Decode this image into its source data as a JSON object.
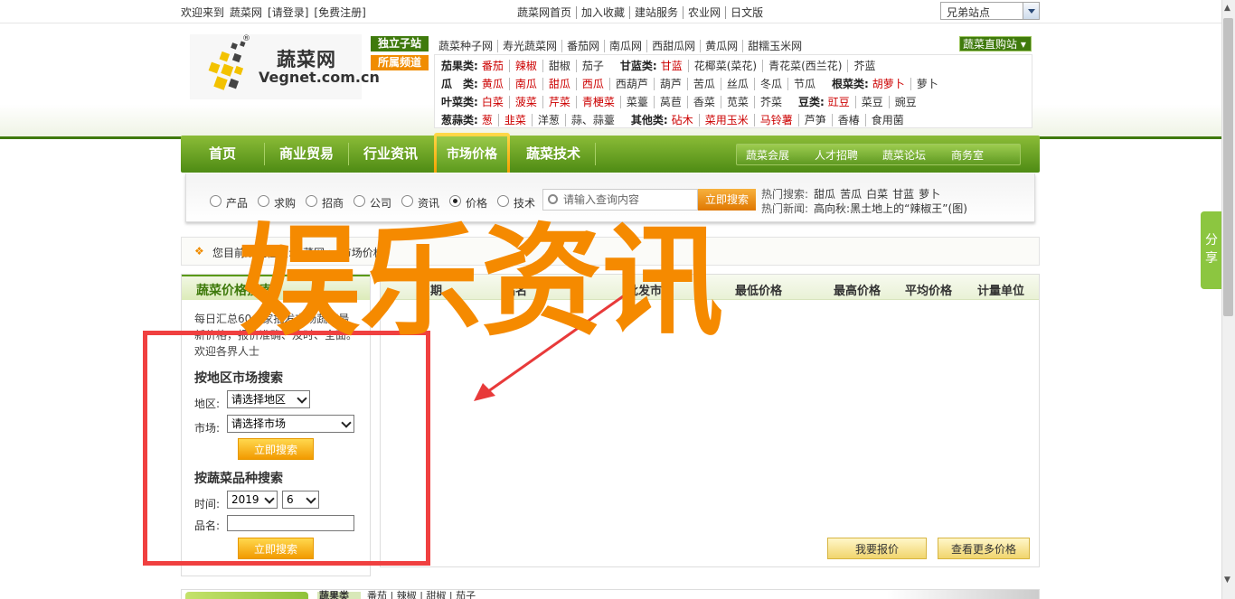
{
  "topbar": {
    "welcome": "欢迎来到",
    "site": "蔬菜网",
    "login": "[请登录]",
    "register": "[免费注册]",
    "links": [
      "蔬菜网首页",
      "加入收藏",
      "建站服务",
      "农业网",
      "日文版"
    ],
    "sister_sites": "兄弟站点"
  },
  "logo": {
    "cn": "蔬菜网",
    "en": "Vegnet.com.cn",
    "reg": "®"
  },
  "tags": {
    "sub": "独立子站",
    "channel": "所属频道",
    "direct": "蔬菜直购站"
  },
  "substations": [
    "蔬菜种子网",
    "寿光蔬菜网",
    "番茄网",
    "南瓜网",
    "西甜瓜网",
    "黄瓜网",
    "甜糯玉米网"
  ],
  "categories": [
    {
      "items": [
        {
          "t": "茄果类:",
          "k": "lbl"
        },
        {
          "t": "番茄",
          "k": "red first"
        },
        {
          "t": "辣椒",
          "k": "red"
        },
        {
          "t": "甜椒",
          "k": ""
        },
        {
          "t": "茄子",
          "k": ""
        },
        {
          "t": "甘蓝类:",
          "k": "lbl2"
        },
        {
          "t": "甘蓝",
          "k": "red first"
        },
        {
          "t": "花椰菜(菜花)",
          "k": ""
        },
        {
          "t": "青花菜(西兰花)",
          "k": ""
        },
        {
          "t": "芥蓝",
          "k": ""
        }
      ]
    },
    {
      "items": [
        {
          "t": "瓜　类:",
          "k": "lbl"
        },
        {
          "t": "黄瓜",
          "k": "red first"
        },
        {
          "t": "南瓜",
          "k": "red"
        },
        {
          "t": "甜瓜",
          "k": "red"
        },
        {
          "t": "西瓜",
          "k": "red"
        },
        {
          "t": "西葫芦",
          "k": ""
        },
        {
          "t": "葫芦",
          "k": ""
        },
        {
          "t": "苦瓜",
          "k": ""
        },
        {
          "t": "丝瓜",
          "k": ""
        },
        {
          "t": "冬瓜",
          "k": ""
        },
        {
          "t": "节瓜",
          "k": ""
        },
        {
          "t": "根菜类:",
          "k": "lbl2"
        },
        {
          "t": "胡萝卜",
          "k": "red first"
        },
        {
          "t": "萝卜",
          "k": ""
        }
      ]
    },
    {
      "items": [
        {
          "t": "叶菜类:",
          "k": "lbl"
        },
        {
          "t": "白菜",
          "k": "red first"
        },
        {
          "t": "菠菜",
          "k": "red"
        },
        {
          "t": "芹菜",
          "k": "red"
        },
        {
          "t": "青梗菜",
          "k": "red"
        },
        {
          "t": "菜薹",
          "k": ""
        },
        {
          "t": "莴苣",
          "k": ""
        },
        {
          "t": "香菜",
          "k": ""
        },
        {
          "t": "苋菜",
          "k": ""
        },
        {
          "t": "芥菜",
          "k": ""
        },
        {
          "t": "豆类:",
          "k": "lbl2"
        },
        {
          "t": "豇豆",
          "k": "red first"
        },
        {
          "t": "菜豆",
          "k": ""
        },
        {
          "t": "豌豆",
          "k": ""
        }
      ]
    },
    {
      "items": [
        {
          "t": "葱蒜类:",
          "k": "lbl"
        },
        {
          "t": "葱",
          "k": "red first"
        },
        {
          "t": "韭菜",
          "k": "red"
        },
        {
          "t": "洋葱",
          "k": ""
        },
        {
          "t": "蒜、蒜薹",
          "k": ""
        },
        {
          "t": "其他类:",
          "k": "lbl2"
        },
        {
          "t": "砧木",
          "k": "red first"
        },
        {
          "t": "菜用玉米",
          "k": "red"
        },
        {
          "t": "马铃薯",
          "k": "red"
        },
        {
          "t": "芦笋",
          "k": ""
        },
        {
          "t": "香椿",
          "k": ""
        },
        {
          "t": "食用菌",
          "k": ""
        }
      ]
    }
  ],
  "nav": {
    "items": [
      "首页",
      "商业贸易",
      "行业资讯",
      "市场价格",
      "蔬菜技术"
    ],
    "active": "市场价格",
    "sub": [
      "蔬菜会展",
      "人才招聘",
      "蔬菜论坛",
      "商务室"
    ]
  },
  "search": {
    "radios": [
      "产品",
      "求购",
      "招商",
      "公司",
      "资讯",
      "价格",
      "技术"
    ],
    "checked": "价格",
    "placeholder": "请输入查询内容",
    "button": "立即搜索",
    "hot_search_label": "热门搜索:",
    "hot_search": [
      "甜瓜",
      "苦瓜",
      "白菜",
      "甘蓝",
      "萝卜"
    ],
    "hot_news_label": "热门新闻:",
    "hot_news": "高向秋:黑土地上的“辣椒王”(图)"
  },
  "share": "分享",
  "breadcrumb": "您目前所在位置:蔬菜网 > 市场价格",
  "left_panel": {
    "title": "蔬菜价格搜索",
    "desc": "每日汇总60多家批发市场蔬菜最新价格，报价准确、及时、全面。欢迎各界人士",
    "by_region": "按地区市场搜索",
    "region_label": "地区:",
    "region_value": "请选择地区",
    "market_label": "市场:",
    "market_value": "请选择市场",
    "search_btn": "立即搜索",
    "by_variety": "按蔬菜品种搜索",
    "time_label": "时间:",
    "year": "2019",
    "month": "6",
    "name_label": "品名:",
    "search_btn2": "立即搜索"
  },
  "table": {
    "headers": [
      "日期",
      "品名",
      "批发市场",
      "最低价格",
      "最高价格",
      "平均价格",
      "计量单位"
    ],
    "quote_btn": "我要报价",
    "more_btn": "查看更多价格"
  },
  "bottom": {
    "tab": "蔬果类",
    "items": "番茄 | 辣椒 | 甜椒 | 茄子"
  },
  "overlay": {
    "watermark": "娱乐资讯",
    "watermark_color": "#f58a00",
    "box_color": "#f04040",
    "arrow_color": "#e83a3a"
  }
}
